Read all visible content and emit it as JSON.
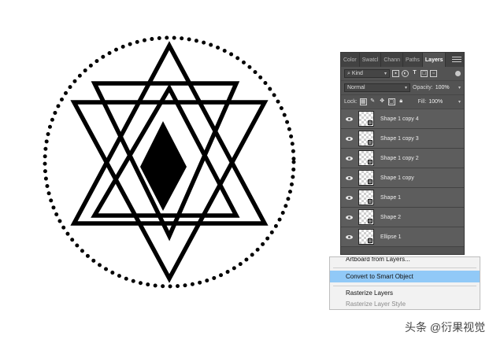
{
  "layers_panel": {
    "tabs": [
      "Color",
      "Swatcl",
      "Chann",
      "Paths",
      "Layers"
    ],
    "active_tab": "Layers",
    "filter": {
      "kind_label": "Kind",
      "icons": [
        "pixel-filter-icon",
        "adjustment-filter-icon",
        "type-filter-icon",
        "shape-filter-icon",
        "smart-object-filter-icon"
      ]
    },
    "blend_mode": "Normal",
    "opacity_label": "Opacity:",
    "opacity_value": "100%",
    "lock_label": "Lock:",
    "fill_label": "Fill:",
    "fill_value": "100%",
    "layers": [
      {
        "name": "Shape 1 copy 4"
      },
      {
        "name": "Shape 1 copy 3"
      },
      {
        "name": "Shape 1 copy 2"
      },
      {
        "name": "Shape 1 copy"
      },
      {
        "name": "Shape 1"
      },
      {
        "name": "Shape 2"
      },
      {
        "name": "Ellipse 1"
      }
    ]
  },
  "context_menu": {
    "items": [
      {
        "label": "Artboard from Layers...",
        "state": "partially-visible"
      },
      {
        "label": "Convert to Smart Object",
        "state": "highlighted"
      },
      {
        "label": "Rasterize Layers",
        "state": "normal"
      },
      {
        "label": "Rasterize Layer Style",
        "state": "disabled"
      }
    ]
  },
  "watermark": "头条 @衍果视觉",
  "colors": {
    "panel_bg": "#535353",
    "highlight": "#91c9f7",
    "artwork": "#000000"
  }
}
